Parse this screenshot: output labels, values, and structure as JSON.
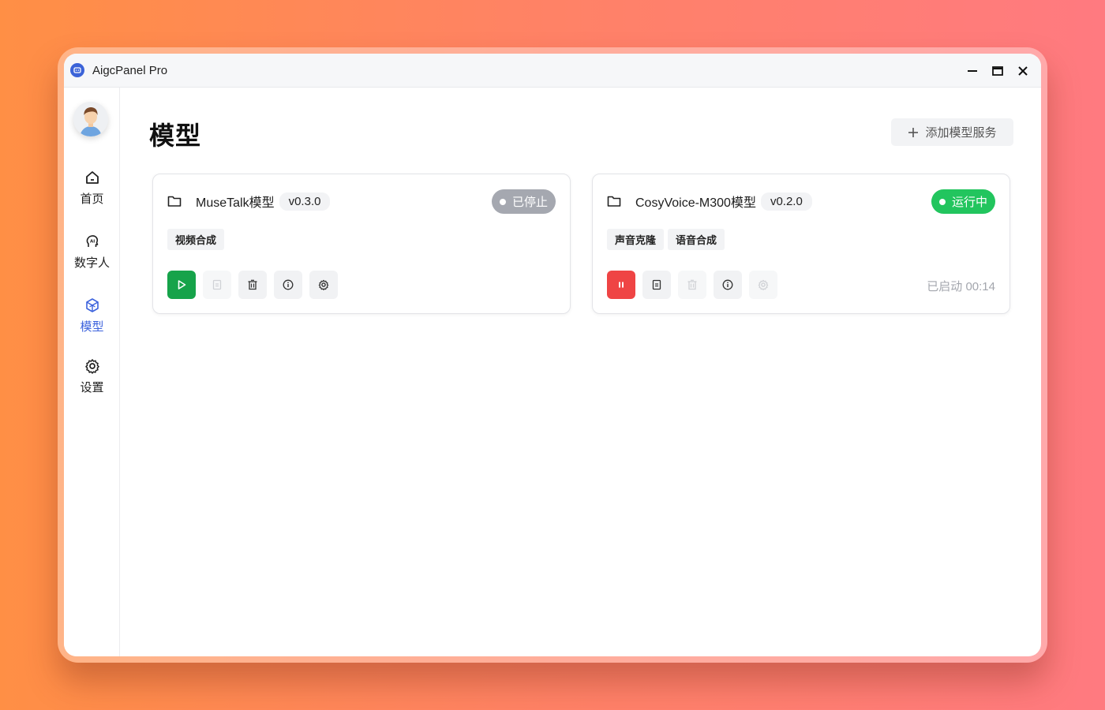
{
  "window": {
    "title": "AigcPanel Pro"
  },
  "sidebar": {
    "items": [
      {
        "label": "首页",
        "icon": "home-icon"
      },
      {
        "label": "数字人",
        "icon": "ai-head-icon"
      },
      {
        "label": "模型",
        "icon": "cube-icon",
        "active": true
      },
      {
        "label": "设置",
        "icon": "gear-icon"
      }
    ]
  },
  "page": {
    "title": "模型",
    "add_button_label": "添加模型服务"
  },
  "models": [
    {
      "name": "MuseTalk模型",
      "version": "v0.3.0",
      "status": "已停止",
      "status_color": "#a5a8b0",
      "tags": [
        "视频合成"
      ],
      "started_text": ""
    },
    {
      "name": "CosyVoice-M300模型",
      "version": "v0.2.0",
      "status": "运行中",
      "status_color": "#22c55e",
      "tags": [
        "声音克隆",
        "语音合成"
      ],
      "started_text": "已启动 00:14"
    }
  ],
  "colors": {
    "accent": "#3d63dd",
    "play": "#16a34a",
    "stop": "#ef4444"
  }
}
